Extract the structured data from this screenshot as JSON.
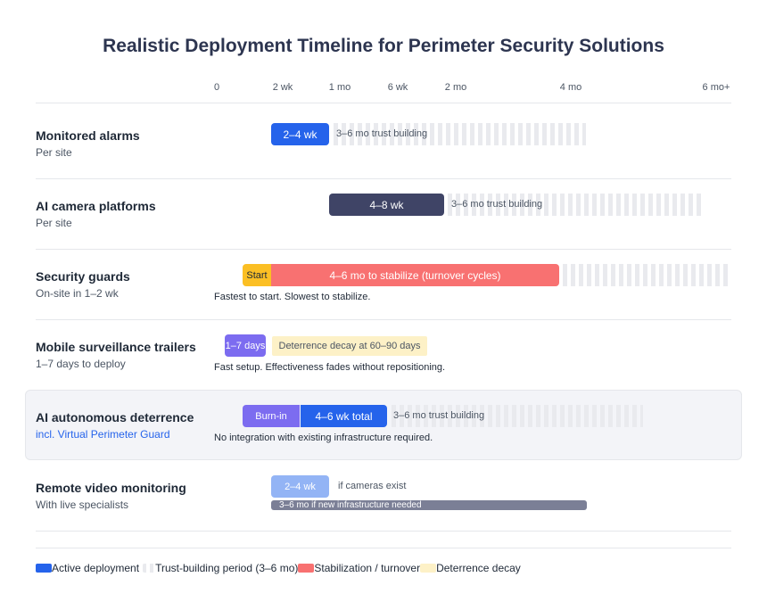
{
  "title": "Realistic Deployment Timeline for Perimeter Security Solutions",
  "axis": {
    "ticks": [
      "0",
      "2 wk",
      "1 mo",
      "6 wk",
      "2 mo",
      "4 mo",
      "6 mo+"
    ]
  },
  "colors": {
    "active": "#2563eb",
    "ai_camera": "#3f4466",
    "stabilization": "#f87171",
    "start": "#fbbf24",
    "trailer": "#7c6cf0",
    "deterrence_decay": "#fdf1c7",
    "burn_in": "#7c6cf0",
    "remote_light": "#93b4f5",
    "remote_infra": "#7b7f96",
    "trust": "#e9eaee"
  },
  "rows": [
    {
      "name": "Monitored alarms",
      "sub": "Per site",
      "bar_label": "2–4 wk",
      "trust_label": "3–6 mo trust building"
    },
    {
      "name": "AI camera platforms",
      "sub": "Per site",
      "bar_label": "4–8 wk",
      "trust_label": "3–6 mo trust building"
    },
    {
      "name": "Security guards",
      "sub": "On-site in 1–2 wk",
      "start_label": "Start",
      "bar_label": "4–6 mo to stabilize (turnover cycles)",
      "caption": "Fastest to start. Slowest to stabilize."
    },
    {
      "name": "Mobile surveillance trailers",
      "sub": "1–7 days to deploy",
      "bar_label": "1–7 days",
      "decay_label": "Deterrence decay at 60–90 days",
      "caption": "Fast setup. Effectiveness fades without repositioning."
    },
    {
      "name": "AI autonomous deterrence",
      "sub": "incl. Virtual Perimeter Guard",
      "burn_label": "Burn-in",
      "bar_label": "4–6 wk total",
      "trust_label": "3–6 mo trust building",
      "caption": "No integration with existing infrastructure required."
    },
    {
      "name": "Remote video monitoring",
      "sub": "With live specialists",
      "bar_label": "2–4 wk",
      "note_label": "if cameras exist",
      "infra_label": "3–6 mo if new infrastructure needed"
    }
  ],
  "legend": [
    {
      "label": "Active deployment"
    },
    {
      "label": "Trust-building period (3–6 mo)"
    },
    {
      "label": "Stabilization / turnover"
    },
    {
      "label": "Deterrence decay"
    }
  ]
}
